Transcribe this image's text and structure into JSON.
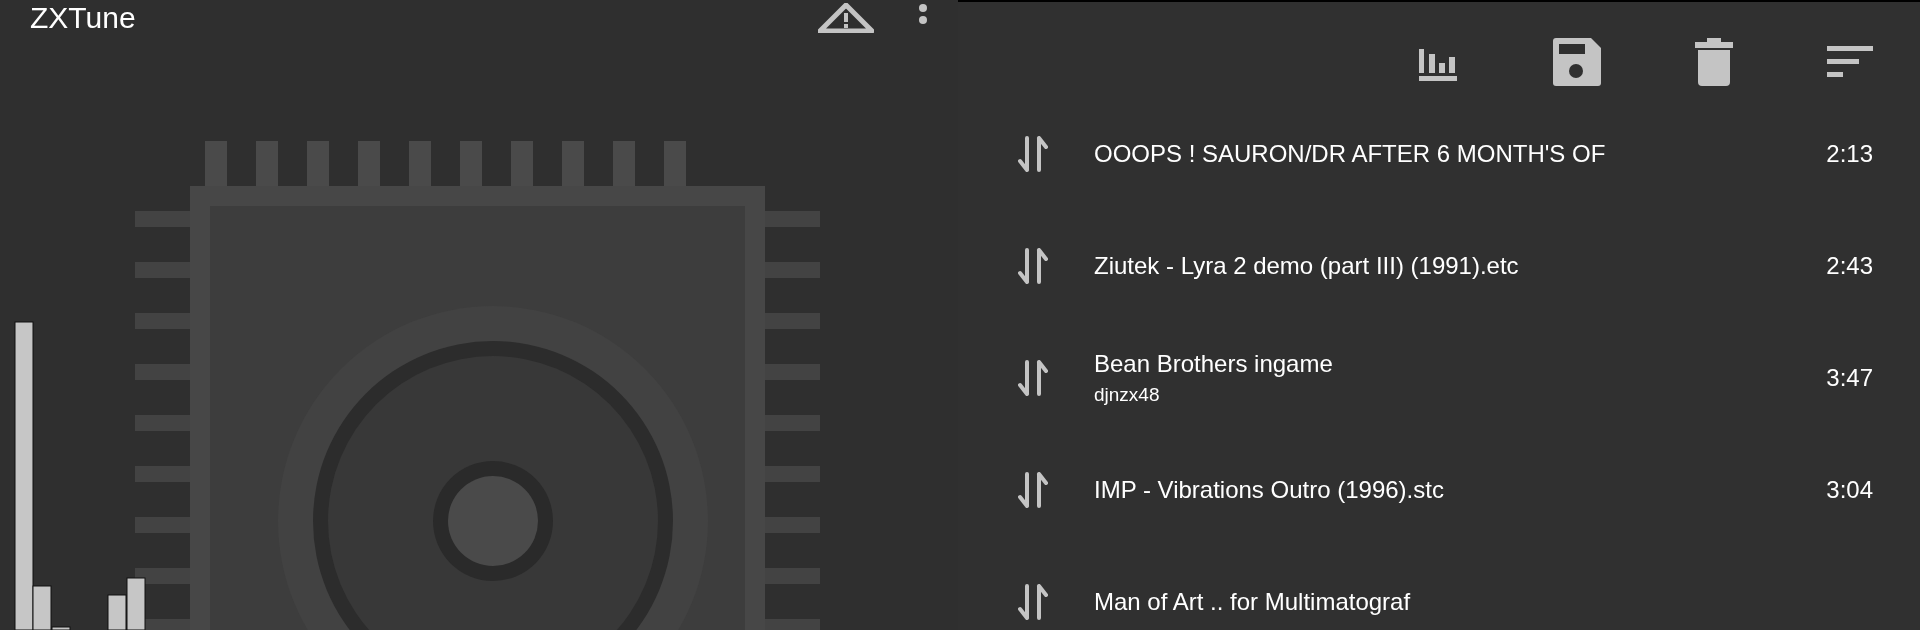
{
  "app_bar": {
    "title": "ZXTune"
  },
  "playlist": {
    "items": [
      {
        "title": "OOOPS ! SAURON/DR AFTER 6 MONTH'S OF",
        "duration": "2:13"
      },
      {
        "title": "Ziutek - Lyra 2 demo (part III) (1991).etc",
        "duration": "2:43"
      },
      {
        "title": "Bean Brothers ingame",
        "subtitle": "djnzx48",
        "duration": "3:47"
      },
      {
        "title": "IMP - Vibrations Outro (1996).stc",
        "duration": "3:04"
      },
      {
        "title": "Man of Art .. for Multimatograf"
      }
    ]
  }
}
